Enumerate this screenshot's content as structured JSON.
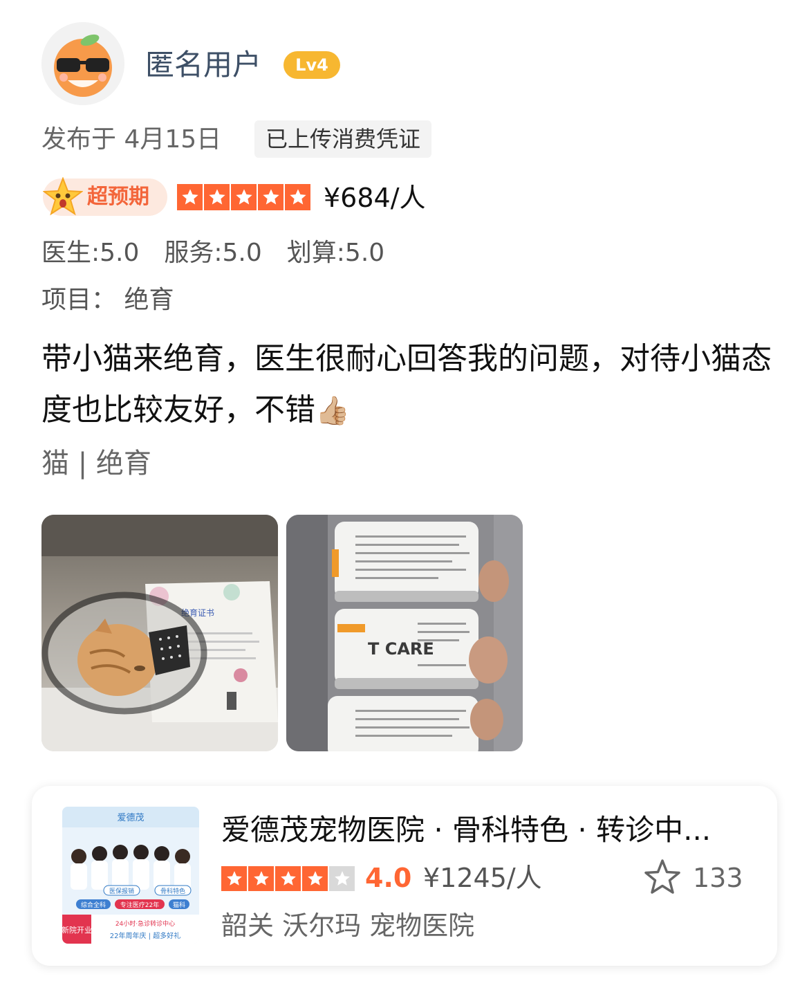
{
  "user": {
    "name": "匿名用户",
    "level": "Lv4"
  },
  "meta": {
    "published": "发布于 4月15日",
    "receipt_tag": "已上传消费凭证"
  },
  "rating": {
    "expectation_label": "超预期",
    "stars": 5,
    "price": "¥684/人"
  },
  "scores": [
    {
      "label": "医生:5.0"
    },
    {
      "label": "服务:5.0"
    },
    {
      "label": "划算:5.0"
    }
  ],
  "project": "项目： 绝育",
  "review": {
    "text": "带小猫来绝育，医生很耐心回答我的问题，对待小猫态度也比较友好，不错",
    "emoji": "👍🏼"
  },
  "tags": "猫 | 绝育",
  "photos": [
    {
      "caption": "绝育证书"
    },
    {
      "caption": "T CARE"
    }
  ],
  "shop": {
    "name": "爱德茂宠物医院 · 骨科特色 · 转诊中...",
    "stars": 4,
    "score": "4.0",
    "price": "¥1245/人",
    "favorites": "133",
    "location": "韶关 沃尔玛 宠物医院",
    "thumb": {
      "brand": "爱德茂",
      "tags": [
        "医保报销",
        "骨科特色",
        "综合全科",
        "专注医疗22年",
        "猫科"
      ],
      "badge": "新院开业",
      "line1": "24小时·急诊转诊中心",
      "line2": "22年周年庆 | 超多好礼"
    }
  },
  "colors": {
    "star_orange": "#ff6633",
    "level_yellow": "#f7b731",
    "expect_text": "#f3653a"
  }
}
